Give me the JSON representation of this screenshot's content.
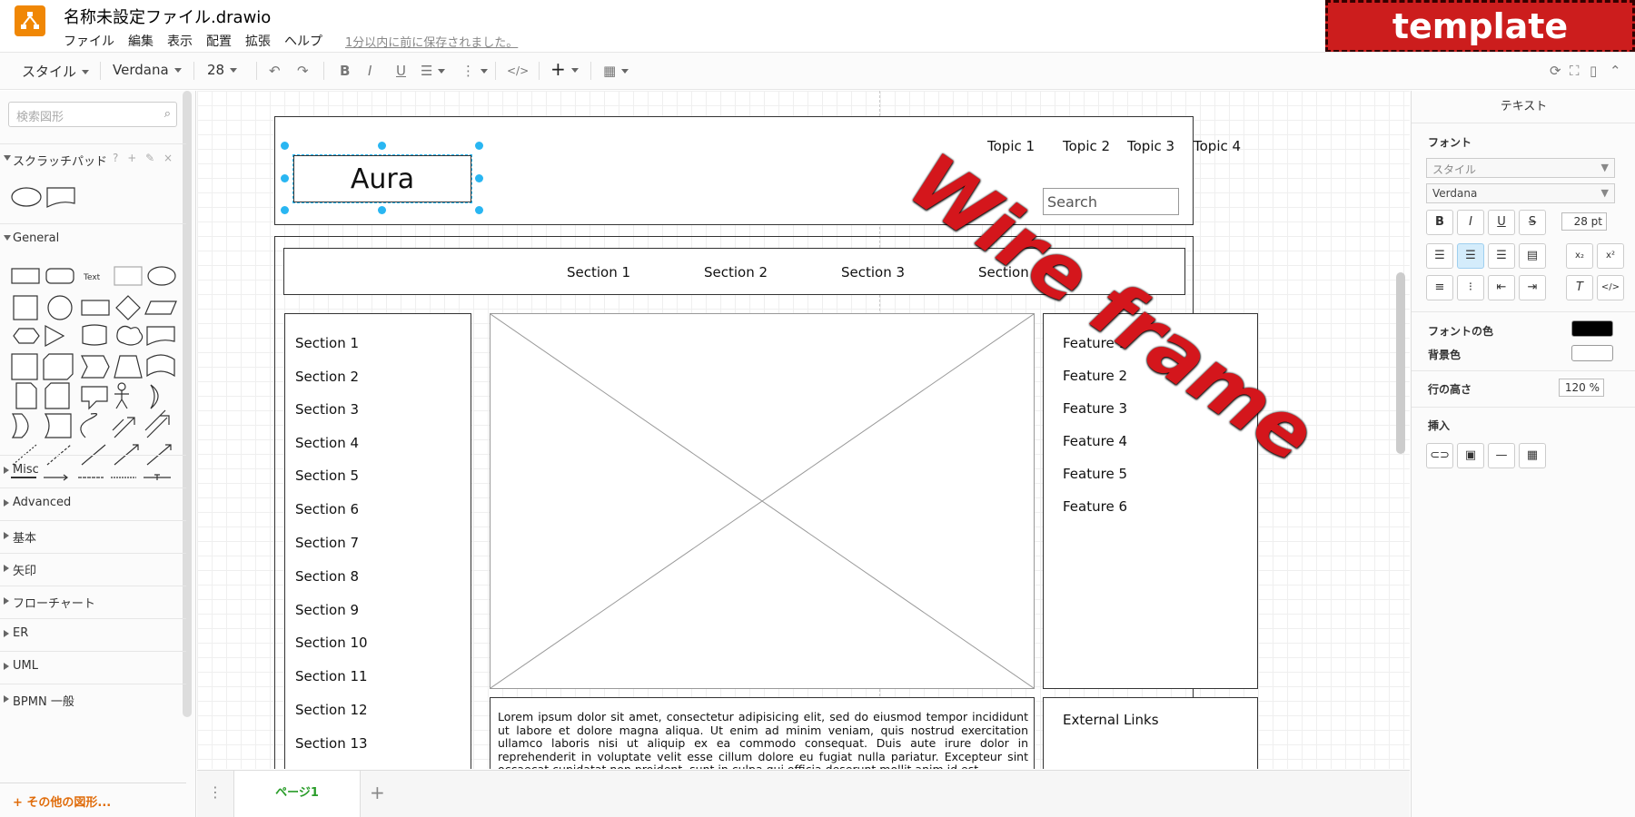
{
  "app": {
    "file_title": "名称未設定ファイル.drawio",
    "menu": [
      "ファイル",
      "編集",
      "表示",
      "配置",
      "拡張",
      "ヘルプ"
    ],
    "save_status": "1分以内に前に保存されました。",
    "banner": "template"
  },
  "toolbar": {
    "style_label": "スタイル",
    "font_label": "Verdana",
    "size_label": "28"
  },
  "sidebar": {
    "search_placeholder": "検索図形",
    "scratchpad": "スクラッチパッド",
    "scratch_tools": "? + ✎ ×",
    "general": "General",
    "sections": [
      "Misc",
      "Advanced",
      "基本",
      "矢印",
      "フローチャート",
      "ER",
      "UML",
      "BPMN 一般"
    ],
    "more_shapes": "+ その他の図形..."
  },
  "canvas": {
    "logo_text": "Aura",
    "topics": [
      "Topic 1",
      "Topic 2",
      "Topic 3",
      "Topic 4"
    ],
    "search_placeholder": "Search",
    "nav_sections": [
      "Section 1",
      "Section 2",
      "Section 3",
      "Section 4"
    ],
    "left_sections": [
      "Section 1",
      "Section 2",
      "Section 3",
      "Section 4",
      "Section 5",
      "Section 6",
      "Section 7",
      "Section 8",
      "Section 9",
      "Section 10",
      "Section 11",
      "Section 12",
      "Section 13"
    ],
    "features": [
      "Feature 1",
      "Feature 2",
      "Feature 3",
      "Feature 4",
      "Feature 5",
      "Feature 6"
    ],
    "lorem": "Lorem ipsum dolor sit amet, consectetur adipisicing elit, sed do eiusmod tempor incididunt ut labore et dolore magna aliqua. Ut enim ad minim veniam, quis nostrud exercitation ullamco laboris nisi ut aliquip ex ea commodo consequat. Duis aute irure dolor in reprehenderit in voluptate velit esse cillum dolore eu fugiat nulla pariatur. Excepteur sint occaecat cupidatat non proident, sunt in culpa qui officia deserunt mollit anim id est",
    "external_links": "External Links",
    "stamp": "Wire frame"
  },
  "pages": {
    "tab": "ページ1",
    "add": "+"
  },
  "format_panel": {
    "tab": "テキスト",
    "font_heading": "フォント",
    "style_select": "スタイル",
    "font_select": "Verdana",
    "font_size": "28 pt",
    "font_color_label": "フォントの色",
    "bg_color_label": "背景色",
    "line_height_label": "行の高さ",
    "line_height": "120 %",
    "insert_label": "挿入",
    "font_color": "#000000",
    "bg_color": "#ffffff"
  },
  "colors": {
    "accent": "#29b6f2",
    "brand": "#f08705",
    "stamp": "#d4161c"
  }
}
